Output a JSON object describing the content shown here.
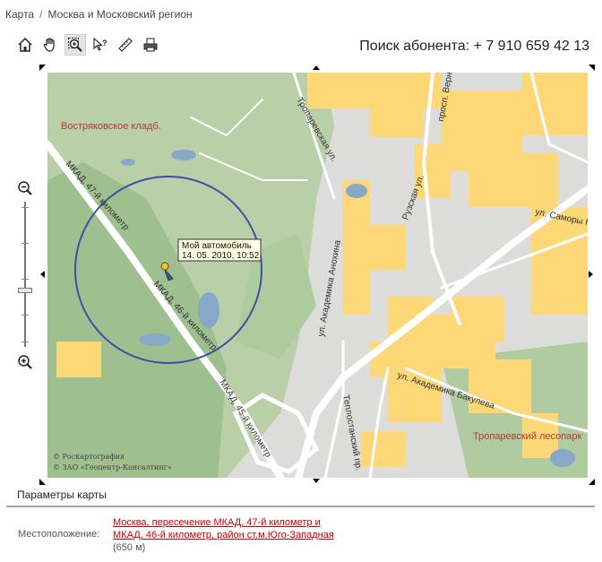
{
  "breadcrumb": {
    "items": [
      "Карта",
      "Москва и Московский регион"
    ],
    "separator": "/"
  },
  "toolbar": {
    "tools": [
      {
        "name": "home",
        "icon": "home-icon"
      },
      {
        "name": "pan",
        "icon": "hand-icon"
      },
      {
        "name": "zoom-area",
        "icon": "zoom-in-box-icon",
        "active": true
      },
      {
        "name": "info",
        "icon": "pointer-question-icon"
      },
      {
        "name": "measure",
        "icon": "ruler-icon"
      },
      {
        "name": "print",
        "icon": "printer-icon"
      }
    ]
  },
  "subscriber": {
    "label": "Поиск абонента: + 7 910 659 42 13"
  },
  "map": {
    "labels": {
      "cemetery": "Востряковское кладб.",
      "mkad47": "МКАД, 47-й километр",
      "mkad46": "МКАД, 46-й километр",
      "mkad45": "МКАД, 45-й километр",
      "troparevskaya": "Тропаревская ул.",
      "ruzskaya": "Рузская ул.",
      "vernadskogo": "просп. Вернадского",
      "samory": "ул. Саморы Машела",
      "anokhina": "ул. Академика Анохина",
      "bakuleva": "ул. Академика Бакулева",
      "teplostanskiy": "Теплостанский пр.",
      "lesopark": "Тропаревский лесопарк"
    },
    "marker": {
      "title": "Мой автомобиль",
      "timestamp": "14. 05. 2010, 10:52"
    },
    "copyright": [
      "© Роскартография",
      "© ЗАО «Геоцентр-Консалтинг»"
    ],
    "colors": {
      "background": "#dcdcda",
      "park": "#a8c59a",
      "buildings": "#fed776",
      "water": "#88a8c8",
      "circle": "#3f4fa8",
      "label_red": "#b23a3a"
    }
  },
  "zoom": {
    "level": 0.27
  },
  "params": {
    "title": "Параметры карты",
    "location_label": "Местоположение:",
    "location_link": "Москва, пересечение МКАД, 47-й километр и МКАД, 46-й километр, район ст.м.Юго-Западная",
    "distance": "(650 м)"
  }
}
